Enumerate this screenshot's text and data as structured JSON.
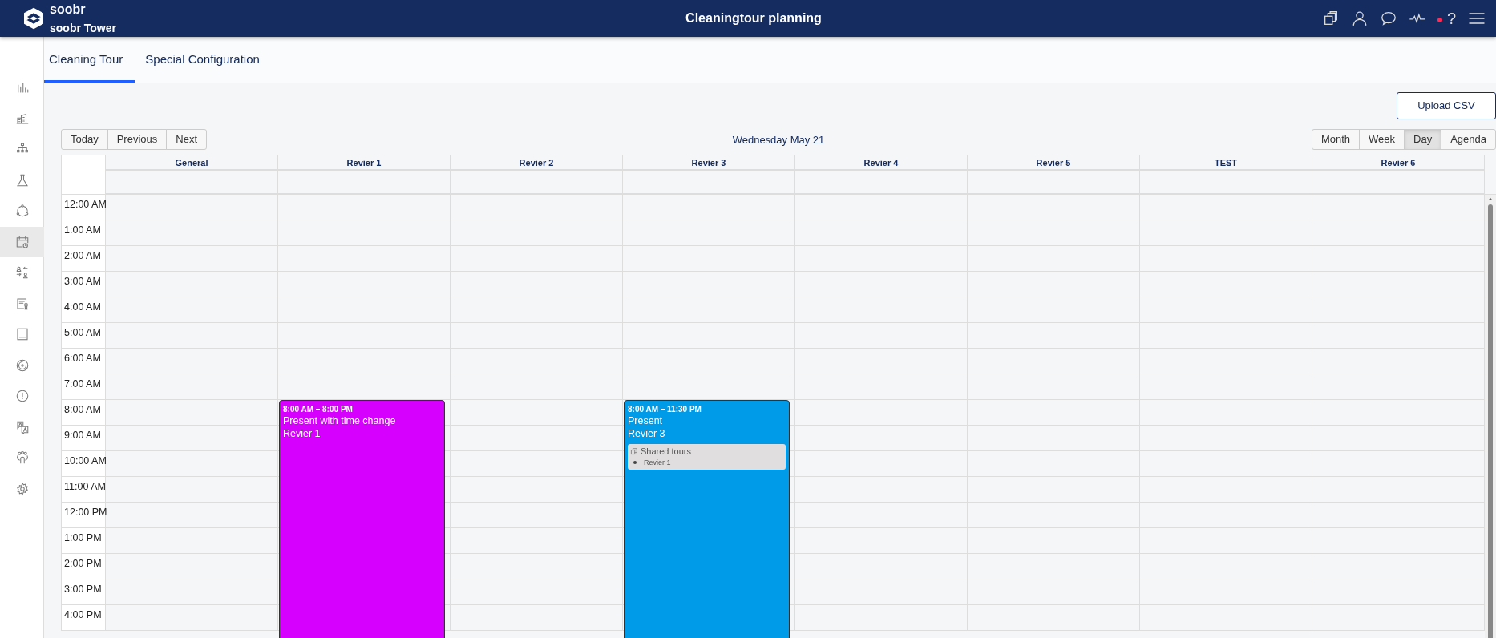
{
  "header": {
    "app_name": "soobr",
    "site": "soobr Tower",
    "title": "Cleaningtour planning",
    "help": "?",
    "notification": true
  },
  "sidebar": {
    "items": [
      {
        "selected": false
      },
      {
        "selected": false
      },
      {
        "selected": false
      },
      {
        "selected": false
      },
      {
        "selected": false
      },
      {
        "selected": true
      },
      {
        "selected": false
      },
      {
        "selected": false
      },
      {
        "selected": false
      },
      {
        "selected": false
      },
      {
        "selected": false
      },
      {
        "selected": false
      },
      {
        "selected": false
      },
      {
        "selected": false
      }
    ]
  },
  "tabs": [
    {
      "label": "Cleaning Tour",
      "selected": true
    },
    {
      "label": "Special Configuration",
      "selected": false
    }
  ],
  "upload_button": "Upload CSV",
  "toolbar": {
    "nav_buttons": [
      "Today",
      "Previous",
      "Next"
    ],
    "date": "Wednesday May 21",
    "views": [
      {
        "label": "Month",
        "selected": false
      },
      {
        "label": "Week",
        "selected": false
      },
      {
        "label": "Day",
        "selected": true
      },
      {
        "label": "Agenda",
        "selected": false
      }
    ]
  },
  "calendar": {
    "time_slots": [
      "12:00 AM",
      "1:00 AM",
      "2:00 AM",
      "3:00 AM",
      "4:00 AM",
      "5:00 AM",
      "6:00 AM",
      "7:00 AM",
      "8:00 AM",
      "9:00 AM",
      "10:00 AM",
      "11:00 AM",
      "12:00 PM",
      "1:00 PM",
      "2:00 PM",
      "3:00 PM",
      "4:00 PM"
    ],
    "columns": [
      {
        "name": "General"
      },
      {
        "name": "Revier 1",
        "events": [
          {
            "time": "8:00 AM – 8:00 PM",
            "title": "Present with time change",
            "subtitle": "Revier 1",
            "color": "#d600ff"
          }
        ]
      },
      {
        "name": "Revier 2"
      },
      {
        "name": "Revier 3",
        "events": [
          {
            "time": "8:00 AM – 11:30 PM",
            "title": "Present",
            "subtitle": "Revier 3",
            "color": "#009be8",
            "shared": {
              "title": "Shared tours",
              "items": [
                "Revier 1"
              ]
            }
          }
        ]
      },
      {
        "name": "Revier 4"
      },
      {
        "name": "Revier 5"
      },
      {
        "name": "TEST"
      },
      {
        "name": "Revier 6"
      }
    ]
  }
}
